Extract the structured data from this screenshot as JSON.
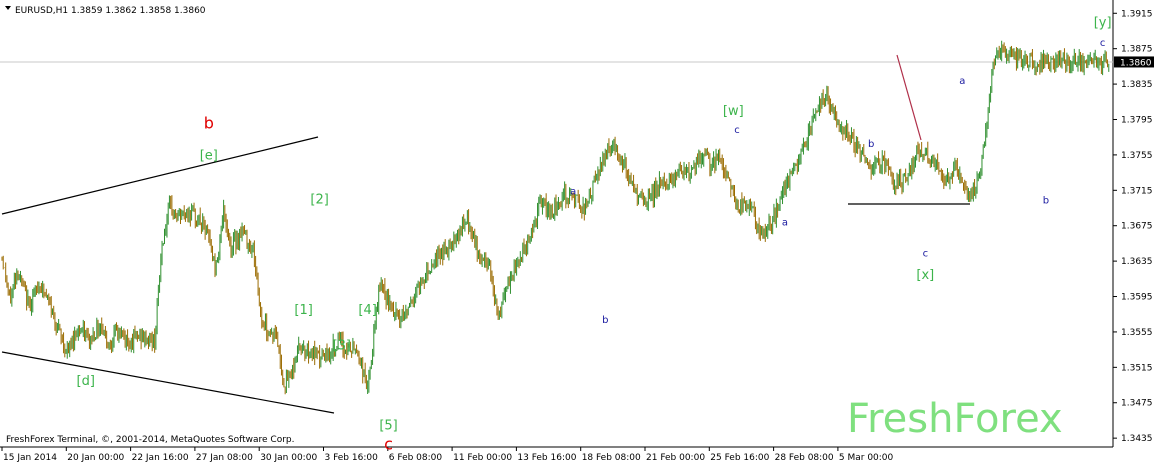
{
  "chart_data": {
    "type": "line",
    "symbol_header": "EURUSD,H1  1.3859 1.3862 1.3858 1.3860",
    "current_price_label": "1.3860",
    "current_price": 1.386,
    "ylim": [
      1.3425,
      1.393
    ],
    "y_ticks": [
      "1.3915",
      "1.3875",
      "1.3835",
      "1.3795",
      "1.3755",
      "1.3715",
      "1.3675",
      "1.3635",
      "1.3595",
      "1.3555",
      "1.3515",
      "1.3475",
      "1.3435"
    ],
    "x_ticks": [
      "15 Jan 2014",
      "20 Jan 00:00",
      "22 Jan 16:00",
      "27 Jan 08:00",
      "30 Jan 00:00",
      "3 Feb 16:00",
      "6 Feb 08:00",
      "11 Feb 00:00",
      "13 Feb 16:00",
      "18 Feb 08:00",
      "21 Feb 00:00",
      "25 Feb 16:00",
      "28 Feb 08:00",
      "5 Mar 00:00"
    ],
    "x_tick_index": [
      0,
      42,
      84,
      126,
      168,
      210,
      252,
      294,
      336,
      378,
      420,
      462,
      504,
      546
    ],
    "bar_count": 581,
    "series": [
      {
        "values_index": [
          0,
          4,
          8,
          14,
          20,
          26,
          34,
          40,
          46,
          52,
          56,
          60,
          66,
          72,
          80,
          84,
          88,
          92,
          98,
          104,
          108,
          112,
          116,
          120,
          126,
          132,
          136,
          140,
          144,
          148,
          152,
          156,
          160,
          166,
          172,
          176,
          180,
          186,
          192,
          198,
          204,
          210,
          216,
          222,
          228,
          234,
          238,
          244,
          250,
          256,
          260,
          266,
          272,
          278,
          282,
          288,
          294,
          300,
          306,
          312,
          318,
          322,
          326,
          332,
          338,
          344,
          350,
          356,
          362,
          368,
          372,
          376,
          380,
          386,
          392,
          398,
          404,
          410,
          416,
          420,
          426,
          432,
          438,
          444,
          450,
          456,
          462,
          468,
          474,
          480,
          486,
          490,
          494,
          498,
          500,
          504,
          508,
          512,
          516,
          520,
          524,
          528,
          534,
          540,
          546,
          552,
          558,
          562,
          566,
          570,
          572,
          576,
          580
        ],
        "values": [
          1.364,
          1.359,
          1.3625,
          1.3585,
          1.361,
          1.358,
          1.353,
          1.356,
          1.3545,
          1.3565,
          1.354,
          1.3555,
          1.3545,
          1.355,
          1.3545,
          1.3655,
          1.3695,
          1.3685,
          1.369,
          1.368,
          1.3665,
          1.3625,
          1.369,
          1.365,
          1.367,
          1.3645,
          1.357,
          1.3555,
          1.355,
          1.3495,
          1.351,
          1.354,
          1.3535,
          1.3525,
          1.353,
          1.3545,
          1.3535,
          1.3535,
          1.349,
          1.361,
          1.358,
          1.357,
          1.3595,
          1.362,
          1.364,
          1.365,
          1.3665,
          1.368,
          1.364,
          1.363,
          1.357,
          1.361,
          1.364,
          1.367,
          1.37,
          1.369,
          1.371,
          1.3705,
          1.3695,
          1.373,
          1.3765,
          1.376,
          1.3745,
          1.371,
          1.37,
          1.372,
          1.3725,
          1.374,
          1.3735,
          1.3755,
          1.3745,
          1.375,
          1.3735,
          1.3695,
          1.37,
          1.366,
          1.368,
          1.3715,
          1.374,
          1.376,
          1.38,
          1.3825,
          1.379,
          1.378,
          1.376,
          1.374,
          1.375,
          1.372,
          1.373,
          1.376,
          1.3755,
          1.374,
          1.372,
          1.3735,
          1.3745,
          1.372,
          1.3705,
          1.3725,
          1.378,
          1.386,
          1.387,
          1.3865,
          1.3862,
          1.386,
          1.386,
          1.386,
          1.386,
          1.386,
          1.386,
          1.386,
          1.386,
          1.386,
          1.386
        ]
      }
    ],
    "annotations": [
      {
        "text": "b",
        "color": "red",
        "i": 168,
        "y": 1.3785
      },
      {
        "text": "[e]",
        "color": "green",
        "i": 168,
        "y": 1.375
      },
      {
        "text": "[d]",
        "color": "green",
        "i": 68,
        "y": 1.3495
      },
      {
        "text": "[2]",
        "color": "green",
        "i": 258,
        "y": 1.37
      },
      {
        "text": "[1]",
        "color": "green",
        "i": 245,
        "y": 1.3575
      },
      {
        "text": "[4]",
        "color": "green",
        "i": 297,
        "y": 1.3575
      },
      {
        "text": "[3]",
        "color": "green",
        "i": 276,
        "y": 1.3535
      },
      {
        "text": "[5]",
        "color": "green",
        "i": 314,
        "y": 1.3445
      },
      {
        "text": "c",
        "color": "red",
        "i": 314,
        "y": 1.3422
      },
      {
        "text": "a",
        "color": "blue",
        "i": 464,
        "y": 1.371
      },
      {
        "text": "b",
        "color": "blue",
        "i": 490,
        "y": 1.3565
      },
      {
        "text": "[w]",
        "color": "green",
        "i": 594,
        "y": 1.38
      },
      {
        "text": "c",
        "color": "blue",
        "i": 597,
        "y": 1.378
      },
      {
        "text": "a",
        "color": "blue",
        "i": 636,
        "y": 1.3675
      },
      {
        "text": "b",
        "color": "blue",
        "i": 706,
        "y": 1.3764
      },
      {
        "text": "c",
        "color": "blue",
        "i": 750,
        "y": 1.364
      },
      {
        "text": "[x]",
        "color": "green",
        "i": 750,
        "y": 1.3615
      },
      {
        "text": "a",
        "color": "blue",
        "i": 780,
        "y": 1.3835
      },
      {
        "text": "b",
        "color": "blue",
        "i": 848,
        "y": 1.37
      },
      {
        "text": "[y]",
        "color": "green",
        "i": 894,
        "y": 1.39
      },
      {
        "text": "c",
        "color": "blue",
        "i": 894,
        "y": 1.3878
      }
    ],
    "copyright": "FreshForex Terminal, ©, 2001-2014, MetaQuotes Software Corp.",
    "brand_watermark": "FreshForex",
    "colors": {
      "candle": "#9a6b00",
      "candle_up": "#2f8f2f",
      "grid": "#c8c8c8",
      "line": "#000000",
      "projection": "#b0304a"
    }
  }
}
